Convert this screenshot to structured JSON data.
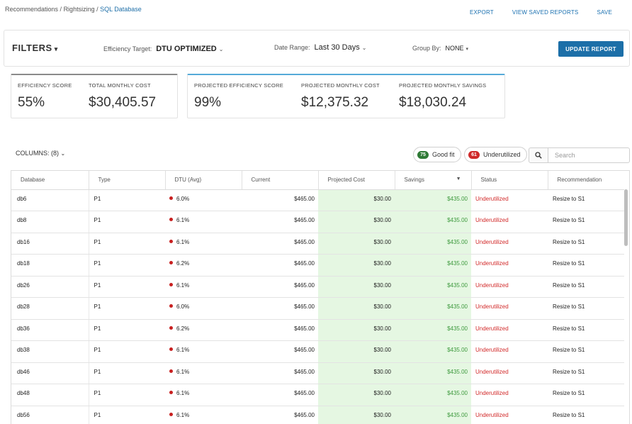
{
  "breadcrumb": [
    "Recommendations",
    "Rightsizing",
    "SQL Database"
  ],
  "breadcrumb_sep": " / ",
  "top_actions": [
    "EXPORT",
    "VIEW SAVED REPORTS",
    "SAVE"
  ],
  "filters": {
    "title": "FILTERS",
    "efficiency_target": {
      "label": "Efficiency Target:",
      "value": "DTU OPTIMIZED"
    },
    "date_range": {
      "label": "Date Range:",
      "value": "Last 30 Days"
    },
    "group_by": {
      "label": "Group By:",
      "value": "NONE"
    },
    "update_button": "UPDATE REPORT"
  },
  "metrics": {
    "efficiency_score": {
      "label": "EFFICIENCY SCORE",
      "value": "55%"
    },
    "total_monthly_cost": {
      "label": "TOTAL MONTHLY COST",
      "value": "$30,405.57"
    },
    "projected_efficiency_score": {
      "label": "PROJECTED EFFICIENCY SCORE",
      "value": "99%"
    },
    "projected_monthly_cost": {
      "label": "PROJECTED MONTHLY COST",
      "value": "$12,375.32"
    },
    "projected_monthly_savings": {
      "label": "PROJECTED MONTHLY SAVINGS",
      "value": "$18,030.24"
    }
  },
  "toolbar": {
    "columns_label": "COLUMNS:",
    "columns_count": "(8)",
    "good_fit": {
      "count": "75",
      "label": "Good fit"
    },
    "underutilized": {
      "count": "61",
      "label": "Underutilized"
    },
    "search_placeholder": "Search"
  },
  "table": {
    "headers": [
      "Database",
      "Type",
      "DTU (Avg)",
      "Current",
      "Projected Cost",
      "Savings",
      "Status",
      "Recommendation"
    ],
    "rows": [
      [
        "db6",
        "P1",
        "6.0%",
        "$465.00",
        "$30.00",
        "$435.00",
        "Underutilized",
        "Resize to S1"
      ],
      [
        "db8",
        "P1",
        "6.1%",
        "$465.00",
        "$30.00",
        "$435.00",
        "Underutilized",
        "Resize to S1"
      ],
      [
        "db16",
        "P1",
        "6.1%",
        "$465.00",
        "$30.00",
        "$435.00",
        "Underutilized",
        "Resize to S1"
      ],
      [
        "db18",
        "P1",
        "6.2%",
        "$465.00",
        "$30.00",
        "$435.00",
        "Underutilized",
        "Resize to S1"
      ],
      [
        "db26",
        "P1",
        "6.1%",
        "$465.00",
        "$30.00",
        "$435.00",
        "Underutilized",
        "Resize to S1"
      ],
      [
        "db28",
        "P1",
        "6.0%",
        "$465.00",
        "$30.00",
        "$435.00",
        "Underutilized",
        "Resize to S1"
      ],
      [
        "db36",
        "P1",
        "6.2%",
        "$465.00",
        "$30.00",
        "$435.00",
        "Underutilized",
        "Resize to S1"
      ],
      [
        "db38",
        "P1",
        "6.1%",
        "$465.00",
        "$30.00",
        "$435.00",
        "Underutilized",
        "Resize to S1"
      ],
      [
        "db46",
        "P1",
        "6.1%",
        "$465.00",
        "$30.00",
        "$435.00",
        "Underutilized",
        "Resize to S1"
      ],
      [
        "db48",
        "P1",
        "6.1%",
        "$465.00",
        "$30.00",
        "$435.00",
        "Underutilized",
        "Resize to S1"
      ],
      [
        "db56",
        "P1",
        "6.1%",
        "$465.00",
        "$30.00",
        "$435.00",
        "Underutilized",
        "Resize to S1"
      ]
    ]
  },
  "colors": {
    "accent": "#1c6fa8",
    "savings_green": "#3e9a3e",
    "status_red": "#d22a2a",
    "projected_bg": "#e5f7e2"
  }
}
